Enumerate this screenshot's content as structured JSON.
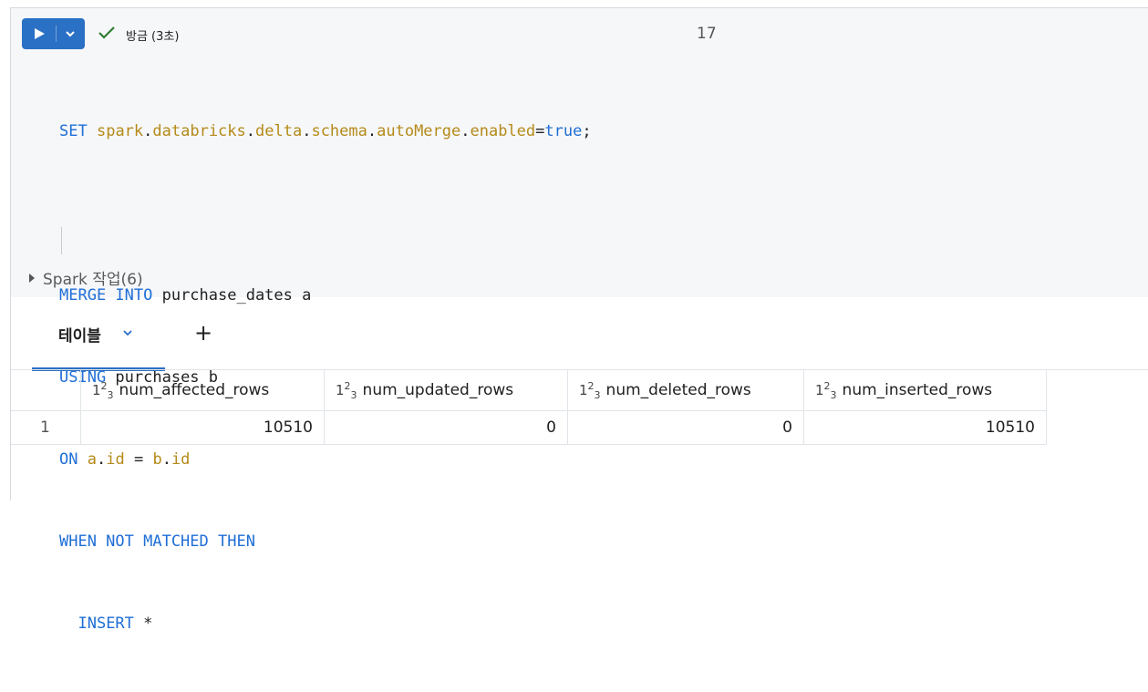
{
  "toolbar": {
    "status": "방금 (3초)",
    "cell_number": "17"
  },
  "code": {
    "line1": {
      "kw": "SET",
      "id1": "spark",
      "id2": "databricks",
      "id3": "delta",
      "id4": "schema",
      "id5": "autoMerge",
      "id6": "enabled",
      "eq": "=",
      "val": "true",
      "end": ";"
    },
    "line3": {
      "kw": "MERGE INTO",
      "rest": " purchase_dates a"
    },
    "line4": {
      "kw": "USING",
      "rest": " purchases b"
    },
    "line5": {
      "kw": "ON",
      "a": "a",
      "aid": "id",
      "eq": " = ",
      "b": "b",
      "bid": "id"
    },
    "line6": {
      "kw": "WHEN NOT MATCHED THEN"
    },
    "line7": {
      "kw": "INSERT",
      "rest": " *"
    }
  },
  "spark_jobs": "Spark 작업(6)",
  "result_tab": {
    "label": "테이블",
    "add": "+"
  },
  "table": {
    "type_icon": {
      "one": "1",
      "two": "2",
      "three": "3"
    },
    "columns": [
      "num_affected_rows",
      "num_updated_rows",
      "num_deleted_rows",
      "num_inserted_rows"
    ],
    "rows": [
      {
        "index": "1",
        "values": [
          "10510",
          "0",
          "0",
          "10510"
        ]
      }
    ]
  },
  "colors": {
    "accent": "#2a70c4",
    "keyword": "#1f6ed6",
    "identifier": "#b48a19",
    "success": "#2e7d32"
  },
  "icons": {
    "run": "play-icon",
    "run_menu": "chevron-down-icon",
    "status": "checkmark-icon",
    "expand": "caret-right-icon",
    "add": "plus-icon"
  }
}
